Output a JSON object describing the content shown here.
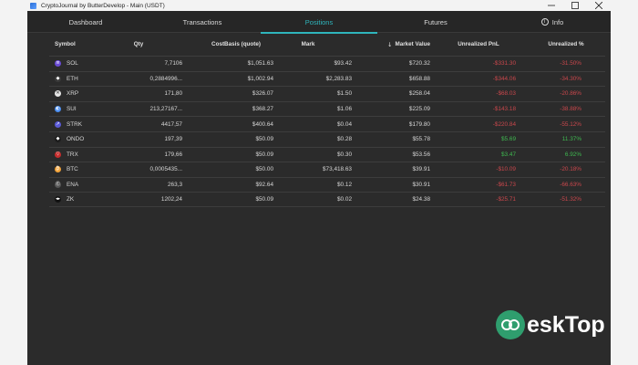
{
  "window": {
    "title": "CryptoJournal by ButterDevelop - Main (USDT)"
  },
  "tabs": [
    {
      "label": "Dashboard"
    },
    {
      "label": "Transactions"
    },
    {
      "label": "Positions"
    },
    {
      "label": "Futures"
    },
    {
      "label": "Info"
    }
  ],
  "table": {
    "columns": [
      "Symbol",
      "Qty",
      "CostBasis (quote)",
      "Mark",
      "Market Value",
      "Unrealized PnL",
      "Unrealized %"
    ],
    "rows": [
      {
        "symbol": "SOL",
        "icon": "sol-icon",
        "qty": "7,7106",
        "cost": "$1,051.63",
        "mark": "$93.42",
        "mv": "$720.32",
        "pnl": "-$331.30",
        "pct": "-31.50%",
        "trend": "neg"
      },
      {
        "symbol": "ETH",
        "icon": "eth-icon",
        "qty": "0,2884996...",
        "cost": "$1,002.94",
        "mark": "$2,283.83",
        "mv": "$658.88",
        "pnl": "-$344.06",
        "pct": "-34.30%",
        "trend": "neg"
      },
      {
        "symbol": "XRP",
        "icon": "xrp-icon",
        "qty": "171,80",
        "cost": "$326.07",
        "mark": "$1.50",
        "mv": "$258.04",
        "pnl": "-$68.03",
        "pct": "-20.86%",
        "trend": "neg"
      },
      {
        "symbol": "SUI",
        "icon": "sui-icon",
        "qty": "213,27167...",
        "cost": "$368.27",
        "mark": "$1.06",
        "mv": "$225.09",
        "pnl": "-$143.18",
        "pct": "-38.88%",
        "trend": "neg"
      },
      {
        "symbol": "STRK",
        "icon": "strk-icon",
        "qty": "4417,57",
        "cost": "$400.64",
        "mark": "$0.04",
        "mv": "$179.80",
        "pnl": "-$220.84",
        "pct": "-55.12%",
        "trend": "neg"
      },
      {
        "symbol": "ONDO",
        "icon": "ondo-icon",
        "qty": "197,39",
        "cost": "$50.09",
        "mark": "$0.28",
        "mv": "$55.78",
        "pnl": "$5.69",
        "pct": "11.37%",
        "trend": "pos"
      },
      {
        "symbol": "TRX",
        "icon": "trx-icon",
        "qty": "179,66",
        "cost": "$50.09",
        "mark": "$0.30",
        "mv": "$53.56",
        "pnl": "$3.47",
        "pct": "6.92%",
        "trend": "pos"
      },
      {
        "symbol": "BTC",
        "icon": "btc-icon",
        "qty": "0,0005435...",
        "cost": "$50.00",
        "mark": "$73,418.63",
        "mv": "$39.91",
        "pnl": "-$10.09",
        "pct": "-20.18%",
        "trend": "neg"
      },
      {
        "symbol": "ENA",
        "icon": "ena-icon",
        "qty": "263,3",
        "cost": "$92.64",
        "mark": "$0.12",
        "mv": "$30.91",
        "pnl": "-$61.73",
        "pct": "-66.63%",
        "trend": "neg"
      },
      {
        "symbol": "ZK",
        "icon": "zk-icon",
        "qty": "1202,24",
        "cost": "$50.09",
        "mark": "$0.02",
        "mv": "$24.38",
        "pnl": "-$25.71",
        "pct": "-51.32%",
        "trend": "neg"
      }
    ]
  },
  "colors": {
    "accent": "#2fb5bc",
    "negative": "#c9474c",
    "positive": "#3fb950",
    "background": "#2b2b2b"
  },
  "watermark": {
    "text": "esk",
    "text2": "Top"
  }
}
